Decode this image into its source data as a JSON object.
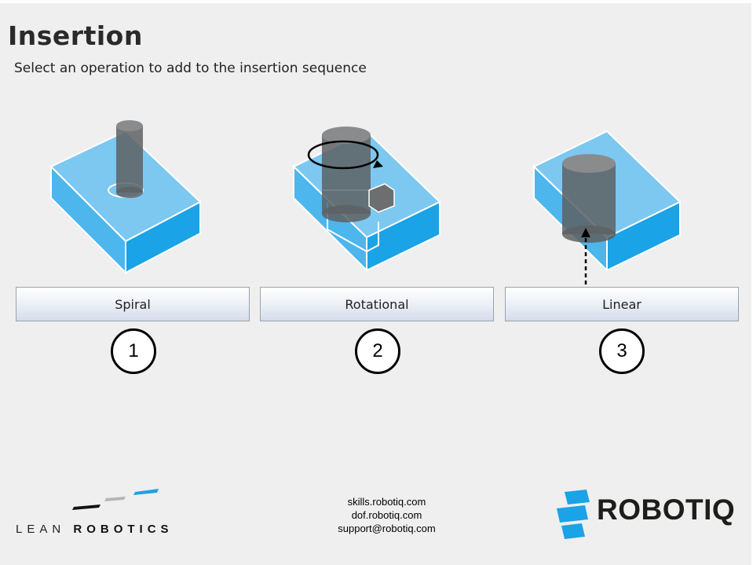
{
  "page": {
    "title": "Insertion",
    "subtitle": "Select an operation to add to the insertion sequence"
  },
  "operations": [
    {
      "label": "Spiral",
      "number": "1",
      "illustration": "spiral-insertion-illustration"
    },
    {
      "label": "Rotational",
      "number": "2",
      "illustration": "rotational-insertion-illustration"
    },
    {
      "label": "Linear",
      "number": "3",
      "illustration": "linear-insertion-illustration"
    }
  ],
  "footer": {
    "lean_robotics": {
      "word1": "LEAN",
      "word2": "ROBOTICS"
    },
    "links": [
      "skills.robotiq.com",
      "dof.robotiq.com",
      "support@robotiq.com"
    ],
    "brand": "ROBOTIQ"
  },
  "colors": {
    "block_top": "#7cc8f0",
    "block_front": "#4db6ec",
    "block_side": "#1aa3e6",
    "cylinder": "#6d6e70",
    "robotiq_blue": "#1aa3e6"
  }
}
